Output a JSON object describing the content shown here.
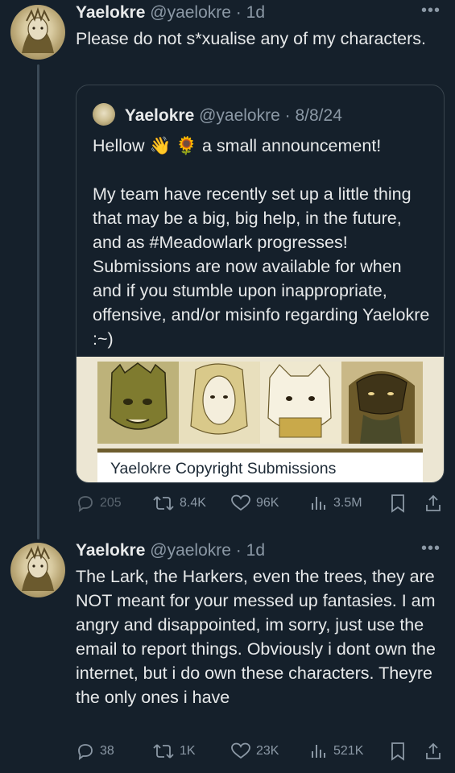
{
  "tweets": [
    {
      "author_name": "Yaelokre",
      "handle": "@yaelokre",
      "separator": "·",
      "time": "1d",
      "more_icon": "more-dots-icon",
      "text": "Please do not s*xualise any of my characters.",
      "quote": {
        "author_name": "Yaelokre",
        "handle": "@yaelokre",
        "separator": "·",
        "date": "8/8/24",
        "line1": "Hellow 👋 🌻 a small announcement!",
        "paragraph": "My team have recently set up a little thing that may be a big, big help, in the future, and as #Meadowlark progresses! Submissions are now available for when and if you stumble upon inappropriate, offensive, and/or misinfo regarding Yaelokre :~)",
        "card_title": "Yaelokre Copyright Submissions"
      },
      "stats": {
        "replies": "205",
        "reposts": "8.4K",
        "likes": "96K",
        "views": "3.5M"
      }
    },
    {
      "author_name": "Yaelokre",
      "handle": "@yaelokre",
      "separator": "·",
      "time": "1d",
      "more_icon": "more-dots-icon",
      "text": "The Lark, the Harkers, even the trees, they are NOT meant for your messed up fantasies. I am angry and disappointed, im sorry, just use the email to report things. Obviously i dont own the internet, but i do own these characters. Theyre the only ones i have",
      "stats": {
        "replies": "38",
        "reposts": "1K",
        "likes": "23K",
        "views": "521K"
      }
    }
  ],
  "colors": {
    "background": "#15202b",
    "text": "#e7e9ea",
    "muted": "#8b98a5",
    "border": "#38444d"
  }
}
